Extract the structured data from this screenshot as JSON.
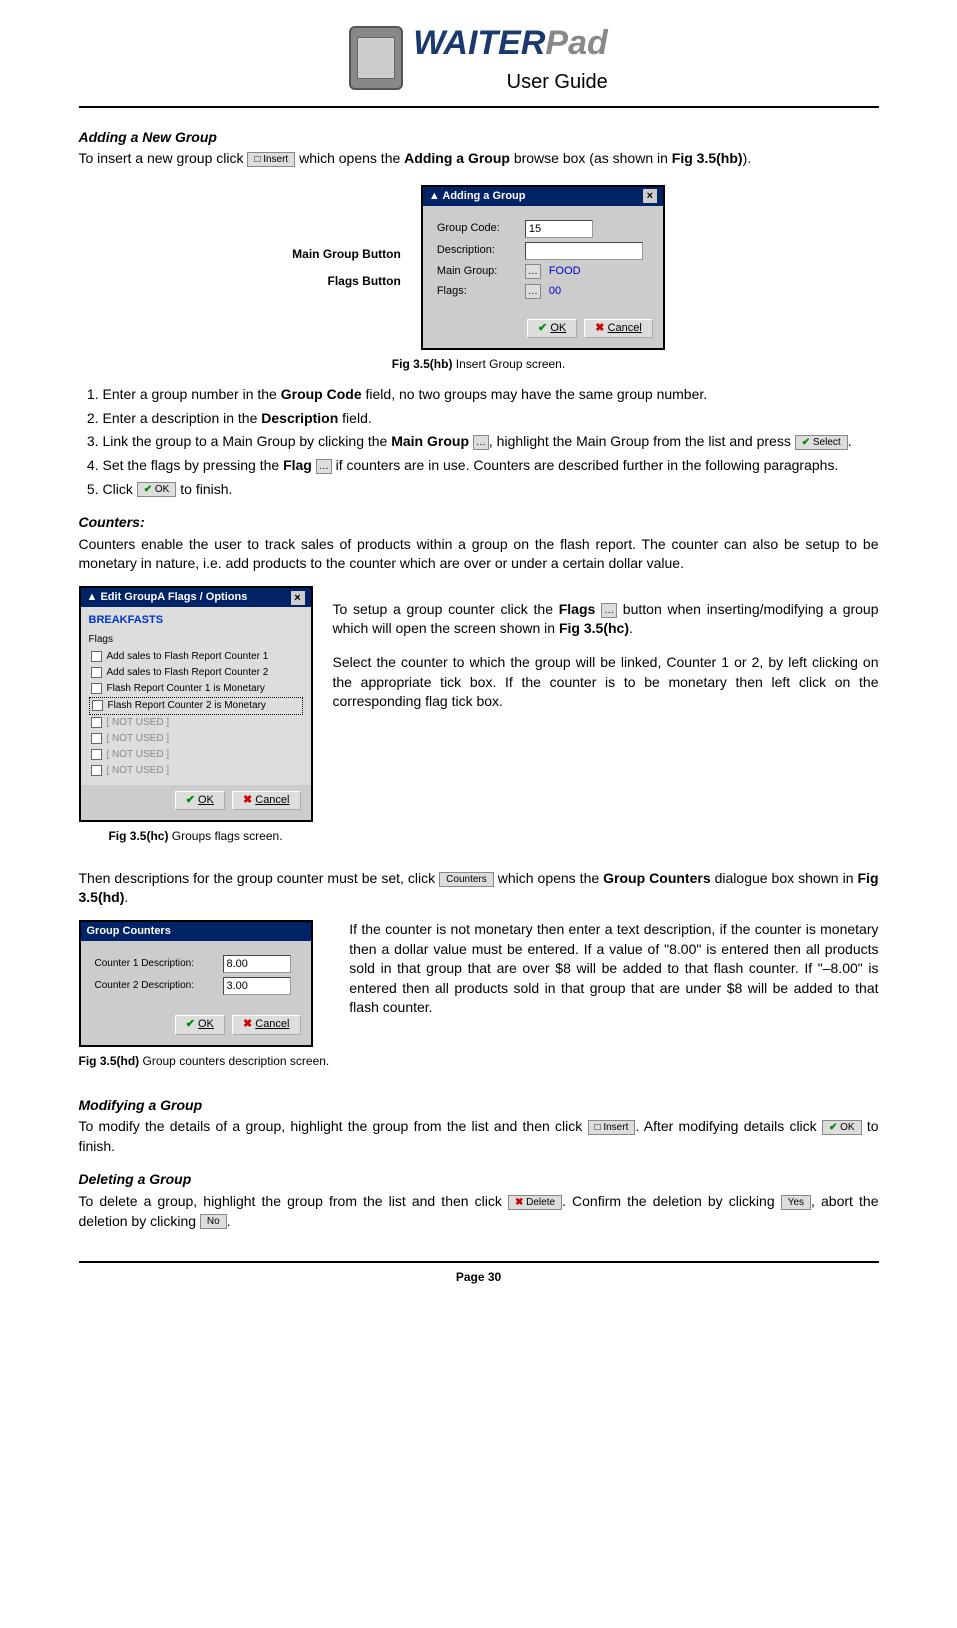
{
  "header": {
    "brand_waiter": "WAITER",
    "brand_pad": "Pad",
    "subtitle": "User Guide"
  },
  "sec1": {
    "title": "Adding a New Group",
    "intro_pre": "To insert a new group click ",
    "insert_btn_label": "Insert",
    "intro_mid": " which opens the ",
    "intro_bold": "Adding a Group",
    "intro_post": " browse box (as shown in ",
    "fig_ref": "Fig 3.5(hb)",
    "intro_end": ")."
  },
  "callout_main_group": "Main Group Button",
  "callout_flags": "Flags Button",
  "dialog_hb": {
    "title": "Adding a Group",
    "label_code": "Group Code:",
    "val_code": "15",
    "label_desc": "Description:",
    "label_main": "Main Group:",
    "val_main": "FOOD",
    "label_flags": "Flags:",
    "val_flags": "00",
    "ok": "OK",
    "cancel": "Cancel"
  },
  "caption_hb_label": "Fig 3.5(hb)",
  "caption_hb_text": " Insert Group screen.",
  "list": {
    "i1_a": "Enter a group number in the ",
    "i1_bold": "Group Code",
    "i1_b": " field, no two groups may have the same group number.",
    "i2_a": "Enter a description in the ",
    "i2_bold": "Description",
    "i2_b": " field.",
    "i3_a": "Link the group to a Main Group by clicking the ",
    "i3_bold": "Main Group",
    "i3_b": ", highlight the Main Group from the list and press ",
    "i3_select": "Select",
    "i3_c": ".",
    "i4_a": "Set the flags by pressing the ",
    "i4_bold": "Flag",
    "i4_b": " if counters are in use. Counters are described further in the following paragraphs.",
    "i5_a": "Click ",
    "i5_ok": "OK",
    "i5_b": " to finish."
  },
  "sec2": {
    "title": "Counters:",
    "intro": "Counters enable the user to track sales of products within a group on the flash report. The counter can also be setup to be monetary in nature, i.e. add products to the counter which are over or under a certain dollar value."
  },
  "dialog_hc": {
    "title": "Edit GroupA Flags / Options",
    "group": "BREAKFASTS",
    "flags_label": "Flags",
    "items": [
      "Add sales to Flash Report Counter 1",
      "Add sales to Flash Report Counter 2",
      "Flash Report Counter 1 is Monetary",
      "Flash Report Counter 2 is Monetary",
      "[ NOT USED ]",
      "[ NOT USED ]",
      "[ NOT USED ]",
      "[ NOT USED ]"
    ],
    "ok": "OK",
    "cancel": "Cancel"
  },
  "caption_hc_label": "Fig 3.5(hc)",
  "caption_hc_text": " Groups flags screen.",
  "para_hc": {
    "p1_a": "To setup a group counter click the ",
    "p1_bold": "Flags",
    "p1_b": " button when inserting/modifying a group which will open the screen shown in ",
    "p1_fig": "Fig 3.5(hc)",
    "p1_c": ".",
    "p2": "Select the counter to which the group will be linked, Counter 1 or 2, by left clicking on the appropriate tick box. If the counter is to be monetary then left click on the corresponding flag tick box."
  },
  "para_hd_intro": {
    "a": "Then descriptions for the group counter must be set, click ",
    "btn": "Counters",
    "b": " which opens the ",
    "bold": "Group Counters",
    "c": " dialogue box shown in ",
    "fig": "Fig 3.5(hd)",
    "d": "."
  },
  "dialog_hd": {
    "title": "Group Counters",
    "label1": "Counter 1 Description:",
    "val1": "8.00",
    "label2": "Counter 2 Description:",
    "val2": "3.00",
    "ok": "OK",
    "cancel": "Cancel"
  },
  "caption_hd_label": "Fig 3.5(hd)",
  "caption_hd_text": " Group counters description screen.",
  "para_hd_body": "If the counter is not monetary then enter a text description, if the counter is monetary then a dollar value must be entered. If a value of \"8.00\" is entered then all products sold in that group that are over $8 will be added to that flash counter. If \"–8.00\" is entered then all products sold in that group that are under $8 will be added to that flash counter.",
  "sec_mod": {
    "title": "Modifying a Group",
    "a": "To modify the details of a group, highlight the group from the list and then click ",
    "btn": "Insert",
    "b": ". After modifying details click ",
    "ok": "OK",
    "c": " to finish."
  },
  "sec_del": {
    "title": "Deleting a Group",
    "a": "To delete a group, highlight the group from the list and then click ",
    "btn": "Delete",
    "b": ". Confirm the deletion by clicking ",
    "yes": "Yes",
    "c": ", abort the deletion by clicking ",
    "no": "No",
    "d": "."
  },
  "footer": "Page 30"
}
